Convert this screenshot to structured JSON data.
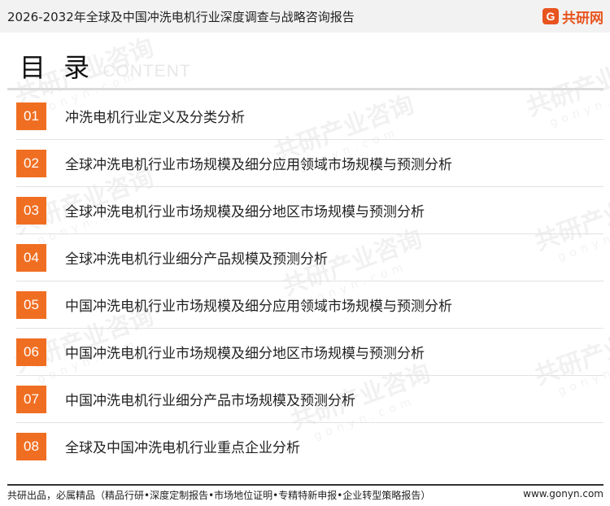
{
  "header": {
    "title": "2026-2032年全球及中国冲洗电机行业深度调查与战略咨询报告",
    "brand_mark": "G",
    "brand_name": "共研网"
  },
  "watermark": {
    "text": "共研产业咨询",
    "url": "gonyn.com"
  },
  "toc": {
    "heading": "目 录",
    "heading_en": "CONTENT",
    "items": [
      {
        "num": "01",
        "text": "冲洗电机行业定义及分类分析"
      },
      {
        "num": "02",
        "text": "全球冲洗电机行业市场规模及细分应用领域市场规模与预测分析"
      },
      {
        "num": "03",
        "text": "全球冲洗电机行业市场规模及细分地区市场规模与预测分析"
      },
      {
        "num": "04",
        "text": "全球冲洗电机行业细分产品规模及预测分析"
      },
      {
        "num": "05",
        "text": "中国冲洗电机行业市场规模及细分应用领域市场规模与预测分析"
      },
      {
        "num": "06",
        "text": "中国冲洗电机行业市场规模及细分地区市场规模与预测分析"
      },
      {
        "num": "07",
        "text": "中国冲洗电机行业细分产品市场规模及预测分析"
      },
      {
        "num": "08",
        "text": "全球及中国冲洗电机行业重点企业分析"
      }
    ]
  },
  "footer": {
    "left": "共研出品，必属精品（精品行研•深度定制报告•市场地位证明•专精特新申报•企业转型策略报告）",
    "right": "www.gonyn.com"
  },
  "colors": {
    "accent": "#f06e22",
    "brand": "#e8541e",
    "header_bg": "#f2f2f2"
  }
}
